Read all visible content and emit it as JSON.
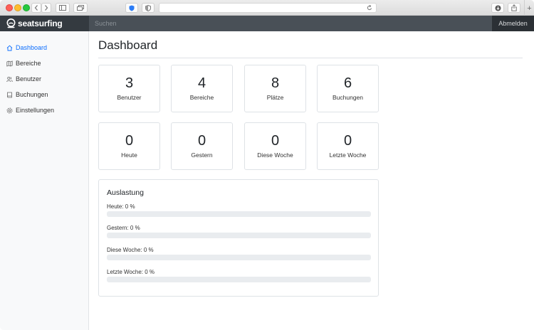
{
  "navbar": {
    "brand": "seatsurfing",
    "search_placeholder": "Suchen",
    "logout_label": "Abmelden"
  },
  "sidebar": {
    "items": [
      {
        "label": "Dashboard",
        "icon": "home-icon",
        "active": true
      },
      {
        "label": "Bereiche",
        "icon": "map-icon",
        "active": false
      },
      {
        "label": "Benutzer",
        "icon": "users-icon",
        "active": false
      },
      {
        "label": "Buchungen",
        "icon": "book-icon",
        "active": false
      },
      {
        "label": "Einstellungen",
        "icon": "gear-icon",
        "active": false
      }
    ]
  },
  "main": {
    "title": "Dashboard",
    "stats": [
      {
        "value": "3",
        "label": "Benutzer"
      },
      {
        "value": "4",
        "label": "Bereiche"
      },
      {
        "value": "8",
        "label": "Plätze"
      },
      {
        "value": "6",
        "label": "Buchungen"
      },
      {
        "value": "0",
        "label": "Heute"
      },
      {
        "value": "0",
        "label": "Gestern"
      },
      {
        "value": "0",
        "label": "Diese Woche"
      },
      {
        "value": "0",
        "label": "Letzte Woche"
      }
    ],
    "utilization": {
      "title": "Auslastung",
      "rows": [
        {
          "label": "Heute: 0 %",
          "percent": 0
        },
        {
          "label": "Gestern: 0 %",
          "percent": 0
        },
        {
          "label": "Diese Woche: 0 %",
          "percent": 0
        },
        {
          "label": "Letzte Woche: 0 %",
          "percent": 0
        }
      ]
    }
  },
  "colors": {
    "navbar": "#343a40",
    "accent": "#0d6efd",
    "track": "#e9ecef"
  }
}
